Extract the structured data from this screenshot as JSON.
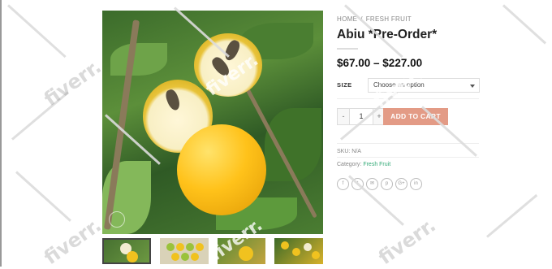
{
  "breadcrumb": {
    "home": "HOME",
    "separator": "/",
    "category": "FRESH FRUIT"
  },
  "product": {
    "title": "Abiu *Pre-Order*",
    "price_range": "$67.00 – $227.00"
  },
  "variation": {
    "label": "SIZE",
    "select_value": "Choose an option"
  },
  "cart": {
    "minus": "-",
    "quantity": "1",
    "plus": "+",
    "add_label": "ADD TO CART"
  },
  "meta": {
    "sku": "SKU: N/A",
    "category_label": "Category:",
    "category_link": "Fresh Fruit"
  },
  "share_icons": [
    "f",
    "t",
    "✉",
    "p",
    "G+",
    "in"
  ],
  "watermark": "fiverr.",
  "colors": {
    "add_to_cart": "#e39b86",
    "link": "#33aa77",
    "fruit": "#ffc21a"
  }
}
